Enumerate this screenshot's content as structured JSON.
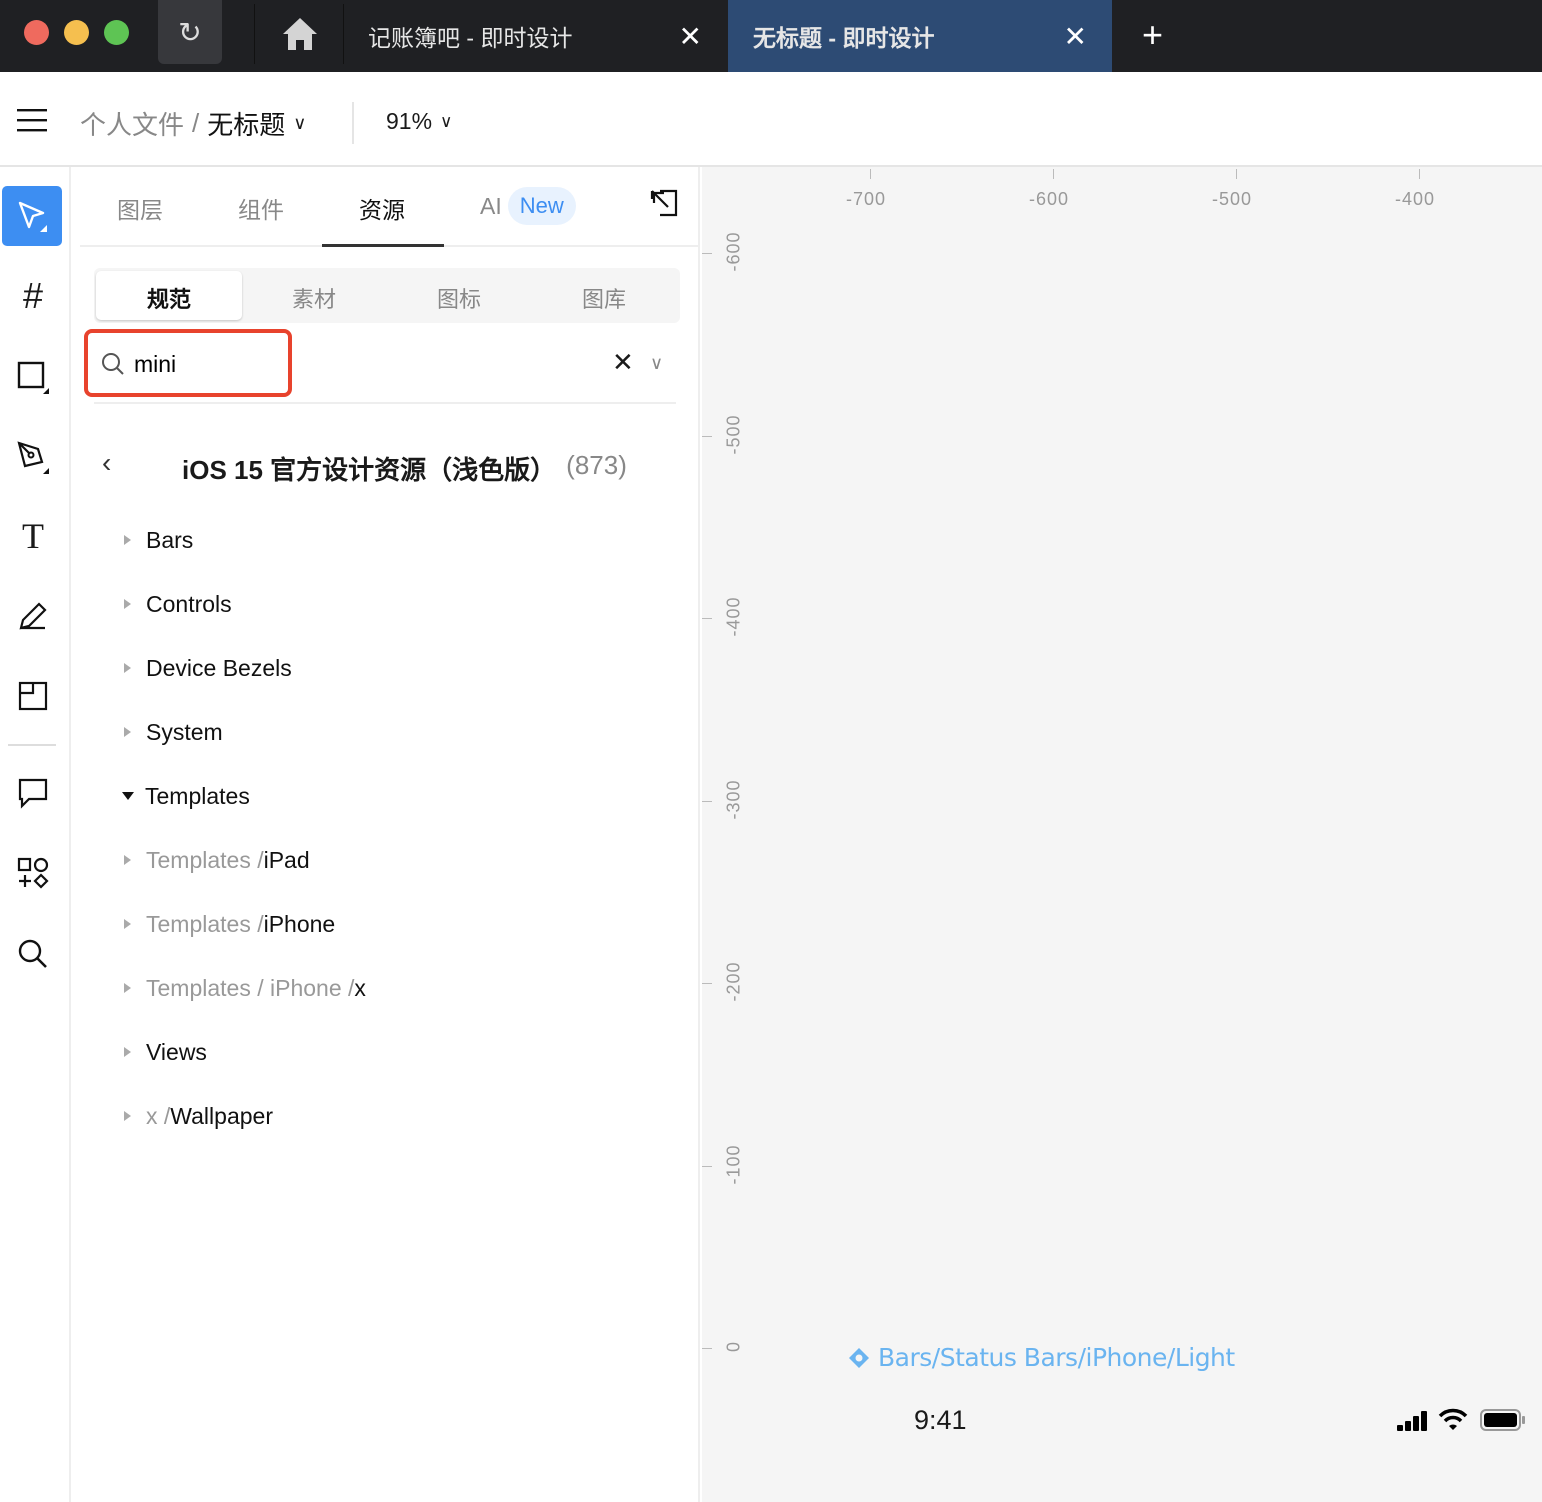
{
  "window": {
    "reload_icon": "reload-icon",
    "home_icon": "home-icon"
  },
  "tabs": [
    {
      "label": "记账簿吧 - 即时设计",
      "active": false
    },
    {
      "label": "无标题 - 即时设计",
      "active": true
    }
  ],
  "toolbar": {
    "breadcrumb_parent": "个人文件",
    "breadcrumb_sep": "/",
    "file_name": "无标题",
    "zoom": "91%"
  },
  "panel": {
    "tabs": [
      {
        "label": "图层"
      },
      {
        "label": "组件"
      },
      {
        "label": "资源",
        "active": true
      },
      {
        "label": "AI"
      }
    ],
    "ai_badge": "New",
    "segments": [
      {
        "label": "规范",
        "active": true
      },
      {
        "label": "素材"
      },
      {
        "label": "图标"
      },
      {
        "label": "图库"
      }
    ],
    "search": {
      "value": "mini",
      "placeholder": ""
    },
    "library": {
      "title": "iOS 15 官方设计资源（浅色版）",
      "count": "(873)"
    },
    "tree": [
      {
        "prefix": "",
        "label": "Bars",
        "open": false
      },
      {
        "prefix": "",
        "label": "Controls",
        "open": false
      },
      {
        "prefix": "",
        "label": "Device Bezels",
        "open": false
      },
      {
        "prefix": "",
        "label": "System",
        "open": false
      },
      {
        "prefix": "",
        "label": "Templates",
        "open": true
      },
      {
        "prefix": "Templates / ",
        "label": "iPad",
        "open": false
      },
      {
        "prefix": "Templates / ",
        "label": "iPhone",
        "open": false
      },
      {
        "prefix": "Templates / iPhone / ",
        "label": "x",
        "open": false
      },
      {
        "prefix": "",
        "label": "Views",
        "open": false
      },
      {
        "prefix": "x / ",
        "label": "Wallpaper",
        "open": false
      }
    ]
  },
  "canvas": {
    "ruler_x": [
      "-700",
      "-600",
      "-500",
      "-400"
    ],
    "ruler_y": [
      "-600",
      "-500",
      "-400",
      "-300",
      "-200",
      "-100",
      "0"
    ],
    "component_label": "Bars/Status Bars/iPhone/Light",
    "status_time": "9:41"
  },
  "colors": {
    "accent": "#3d8ef2",
    "highlight": "#e8432d",
    "component": "#6ab4f0",
    "active_tab": "#2d4b74"
  }
}
